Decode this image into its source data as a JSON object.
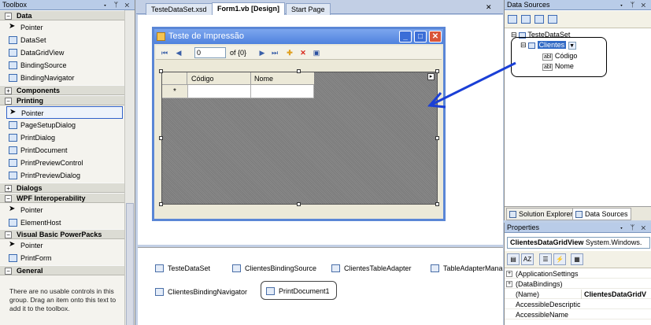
{
  "toolbox": {
    "title": "Toolbox",
    "categories": [
      {
        "label": "Data",
        "items": [
          "Pointer",
          "DataSet",
          "DataGridView",
          "BindingSource",
          "BindingNavigator"
        ]
      },
      {
        "label": "Components",
        "items": []
      },
      {
        "label": "Printing",
        "items": [
          "Pointer",
          "PageSetupDialog",
          "PrintDialog",
          "PrintDocument",
          "PrintPreviewControl",
          "PrintPreviewDialog"
        ]
      },
      {
        "label": "Dialogs",
        "items": []
      },
      {
        "label": "WPF Interoperability",
        "items": [
          "Pointer",
          "ElementHost"
        ]
      },
      {
        "label": "Visual Basic PowerPacks",
        "items": [
          "Pointer",
          "PrintForm"
        ]
      },
      {
        "label": "General",
        "items": []
      }
    ],
    "general_message": "There are no usable controls in this group. Drag an item onto this text to add it to the toolbox."
  },
  "doc_tabs": [
    "TesteDataSet.xsd",
    "Form1.vb [Design]",
    "Start Page"
  ],
  "form": {
    "title": "Teste de Impressão",
    "nav_position": "0",
    "nav_count": "of {0}",
    "grid_columns": [
      "Código",
      "Nome"
    ],
    "new_row_marker": "*"
  },
  "tray": [
    "TesteDataSet",
    "ClientesBindingSource",
    "ClientesTableAdapter",
    "TableAdapterMana",
    "ClientesBindingNavigator",
    "PrintDocument1"
  ],
  "data_sources": {
    "title": "Data Sources",
    "dataset": "TesteDataSet",
    "table": "Clientes",
    "fields": [
      "Código",
      "Nome"
    ]
  },
  "panel_tabs": [
    "Solution Explorer",
    "Data Sources"
  ],
  "properties": {
    "title": "Properties",
    "object_name": "ClientesDataGridView",
    "object_type": "System.Windows.",
    "rows": [
      {
        "name": "(ApplicationSettings",
        "value": "",
        "expandable": true
      },
      {
        "name": "(DataBindings)",
        "value": "",
        "expandable": true
      },
      {
        "name": "(Name)",
        "value": "ClientesDataGridV",
        "expandable": false
      },
      {
        "name": "AccessibleDescriptic",
        "value": "",
        "expandable": false
      },
      {
        "name": "AccessibleName",
        "value": "",
        "expandable": false
      }
    ]
  },
  "colors": {
    "accent_blue": "#1a3fd6",
    "form_title": "#4f82de",
    "selection": "#3162c9"
  }
}
